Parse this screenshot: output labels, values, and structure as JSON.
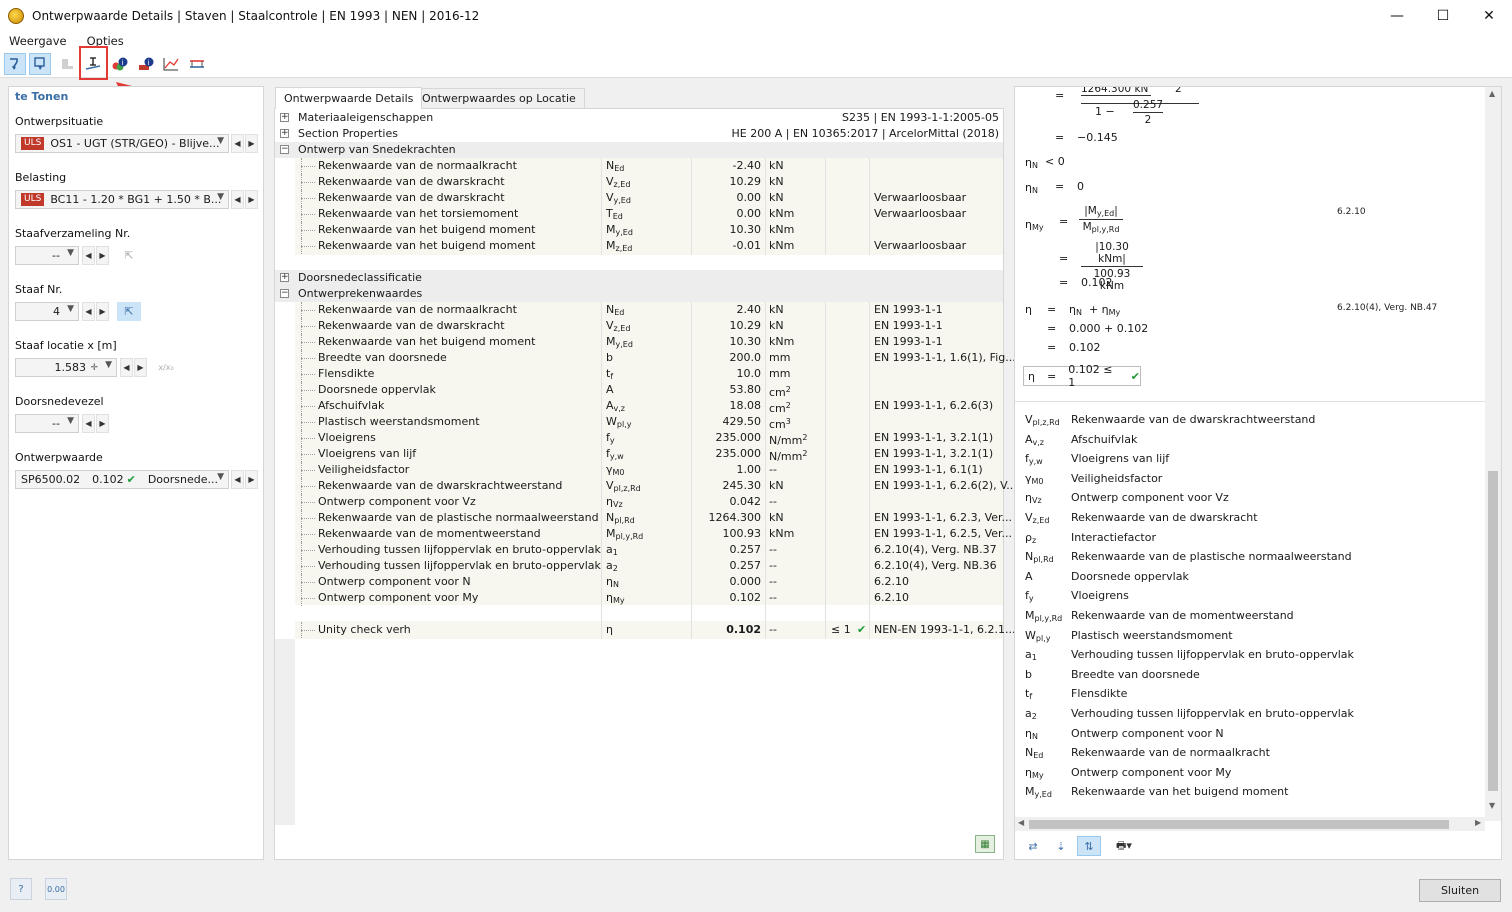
{
  "window": {
    "title": "Ontwerpwaarde Details | Staven | Staalcontrole | EN 1993 | NEN | 2016-12",
    "minimize": "—",
    "maximize": "☐",
    "close": "✕"
  },
  "menu": [
    "Weergave",
    "Opties"
  ],
  "left": {
    "header": "te Tonen",
    "design_situation": {
      "label": "Ontwerpsituatie",
      "badge": "ULS",
      "value": "OS1 - UGT (STR/GEO) - Blijve..."
    },
    "load": {
      "label": "Belasting",
      "badge": "ULS",
      "value": "BC11 - 1.20 * BG1 + 1.50 * B..."
    },
    "member_set": {
      "label": "Staafverzameling Nr.",
      "value": "--"
    },
    "member": {
      "label": "Staaf Nr.",
      "value": "4"
    },
    "location": {
      "label": "Staaf locatie x [m]",
      "value": "1.583",
      "unit_btn": "x/x₀"
    },
    "fiber": {
      "label": "Doorsnedevezel",
      "value": "--"
    },
    "design_value": {
      "label": "Ontwerpwaarde",
      "id": "SP6500.02",
      "ratio": "0.102",
      "type": "Doorsnede..."
    }
  },
  "tabs": [
    "Ontwerpwaarde Details",
    "Ontwerpwaardes op Locatie"
  ],
  "groups": {
    "material": {
      "name": "Materiaaleigenschappen",
      "value": "S235 | EN 1993-1-1:2005-05"
    },
    "section": {
      "name": "Section Properties",
      "value": "HE 200 A | EN 10365:2017 | ArcelorMittal (2018)"
    },
    "forces": {
      "name": "Ontwerp van Snedekrachten"
    },
    "classification": {
      "name": "Doorsnedeclassificatie"
    },
    "design": {
      "name": "Ontwerprekenwaardes"
    }
  },
  "forces_rows": [
    {
      "desc": "Rekenwaarde van de normaalkracht",
      "sym": "N",
      "sub": "Ed",
      "val": "-2.40",
      "unit": "kN",
      "note": ""
    },
    {
      "desc": "Rekenwaarde van de dwarskracht",
      "sym": "V",
      "sub": "z,Ed",
      "val": "10.29",
      "unit": "kN",
      "note": ""
    },
    {
      "desc": "Rekenwaarde van de dwarskracht",
      "sym": "V",
      "sub": "y,Ed",
      "val": "0.00",
      "unit": "kN",
      "note": "Verwaarloosbaar"
    },
    {
      "desc": "Rekenwaarde van het torsiemoment",
      "sym": "T",
      "sub": "Ed",
      "val": "0.00",
      "unit": "kNm",
      "note": "Verwaarloosbaar"
    },
    {
      "desc": "Rekenwaarde van het buigend moment",
      "sym": "M",
      "sub": "y,Ed",
      "val": "10.30",
      "unit": "kNm",
      "note": ""
    },
    {
      "desc": "Rekenwaarde van het buigend moment",
      "sym": "M",
      "sub": "z,Ed",
      "val": "-0.01",
      "unit": "kNm",
      "note": "Verwaarloosbaar"
    }
  ],
  "design_rows": [
    {
      "desc": "Rekenwaarde van de normaalkracht",
      "sym": "N",
      "sub": "Ed",
      "val": "2.40",
      "unit": "kN",
      "note": "EN 1993-1-1"
    },
    {
      "desc": "Rekenwaarde van de dwarskracht",
      "sym": "V",
      "sub": "z,Ed",
      "val": "10.29",
      "unit": "kN",
      "note": "EN 1993-1-1"
    },
    {
      "desc": "Rekenwaarde van het buigend moment",
      "sym": "M",
      "sub": "y,Ed",
      "val": "10.30",
      "unit": "kNm",
      "note": "EN 1993-1-1"
    },
    {
      "desc": "Breedte van doorsnede",
      "sym": "b",
      "sub": "",
      "val": "200.0",
      "unit": "mm",
      "note": "EN 1993-1-1, 1.6(1), Fig..."
    },
    {
      "desc": "Flensdikte",
      "sym": "t",
      "sub": "f",
      "val": "10.0",
      "unit": "mm",
      "note": ""
    },
    {
      "desc": "Doorsnede oppervlak",
      "sym": "A",
      "sub": "",
      "val": "53.80",
      "unit": "cm",
      "usup": "2",
      "note": ""
    },
    {
      "desc": "Afschuifvlak",
      "sym": "A",
      "sub": "v,z",
      "val": "18.08",
      "unit": "cm",
      "usup": "2",
      "note": "EN 1993-1-1, 6.2.6(3)"
    },
    {
      "desc": "Plastisch weerstandsmoment",
      "sym": "W",
      "sub": "pl,y",
      "val": "429.50",
      "unit": "cm",
      "usup": "3",
      "note": ""
    },
    {
      "desc": "Vloeigrens",
      "sym": "f",
      "sub": "y",
      "val": "235.000",
      "unit": "N/mm",
      "usup": "2",
      "note": "EN 1993-1-1, 3.2.1(1)"
    },
    {
      "desc": "Vloeigrens van lijf",
      "sym": "f",
      "sub": "y,w",
      "val": "235.000",
      "unit": "N/mm",
      "usup": "2",
      "note": "EN 1993-1-1, 3.2.1(1)"
    },
    {
      "desc": "Veiligheidsfactor",
      "sym": "γ",
      "sub": "M0",
      "val": "1.00",
      "unit": "--",
      "note": "EN 1993-1-1, 6.1(1)"
    },
    {
      "desc": "Rekenwaarde van de dwarskrachtweerstand",
      "sym": "V",
      "sub": "pl,z,Rd",
      "val": "245.30",
      "unit": "kN",
      "note": "EN 1993-1-1, 6.2.6(2), V..."
    },
    {
      "desc": "Ontwerp component voor Vz",
      "sym": "η",
      "sub": "Vz",
      "val": "0.042",
      "unit": "--",
      "note": ""
    },
    {
      "desc": "Rekenwaarde van de plastische normaalweerstand",
      "sym": "N",
      "sub": "pl,Rd",
      "val": "1264.300",
      "unit": "kN",
      "note": "EN 1993-1-1, 6.2.3, Ver..."
    },
    {
      "desc": "Rekenwaarde van de momentweerstand",
      "sym": "M",
      "sub": "pl,y,Rd",
      "val": "100.93",
      "unit": "kNm",
      "note": "EN 1993-1-1, 6.2.5, Ver..."
    },
    {
      "desc": "Verhouding tussen lijfoppervlak en bruto-oppervlak",
      "sym": "a",
      "sub": "1",
      "val": "0.257",
      "unit": "--",
      "note": "6.2.10(4), Verg. NB.37"
    },
    {
      "desc": "Verhouding tussen lijfoppervlak en bruto-oppervlak",
      "sym": "a",
      "sub": "2",
      "val": "0.257",
      "unit": "--",
      "note": "6.2.10(4), Verg. NB.36"
    },
    {
      "desc": "Ontwerp component voor N",
      "sym": "η",
      "sub": "N",
      "val": "0.000",
      "unit": "--",
      "note": "6.2.10"
    },
    {
      "desc": "Ontwerp component voor My",
      "sym": "η",
      "sub": "My",
      "val": "0.102",
      "unit": "--",
      "note": "6.2.10"
    }
  ],
  "unity": {
    "desc": "Unity check verh",
    "sym": "η",
    "val": "0.102",
    "unit": "--",
    "limit": "≤ 1",
    "check": "✔",
    "note": "NEN-EN 1993-1-1, 6.2.1..."
  },
  "formula": {
    "top_num": "1264.300 kN",
    "top_den2": "2",
    "one_minus": "1 −",
    "f_num": "0.257",
    "f_den": "2",
    "result1": "−0.145",
    "etaN_cond": "< 0",
    "etaN_val": "0",
    "myed_num": "|My,Ed|",
    "mypl_den": "Mpl,y,Rd",
    "num_val": "|10.30 kNm|",
    "den_val": "100.93 kNm",
    "etaMy_result": "0.102",
    "ref1": "6.2.10",
    "eta_sum_terms": "ηN  +  ηMy",
    "eta_sum_vals": "0.000  +  0.102",
    "eta_result": "0.102",
    "ref2": "6.2.10(4), Verg. NB.47",
    "final": "0.102  ≤ 1",
    "eq": "="
  },
  "legend": [
    {
      "sym": "V",
      "sub": "pl,z,Rd",
      "desc": "Rekenwaarde van de dwarskrachtweerstand"
    },
    {
      "sym": "A",
      "sub": "v,z",
      "desc": "Afschuifvlak"
    },
    {
      "sym": "f",
      "sub": "y,w",
      "desc": "Vloeigrens van lijf"
    },
    {
      "sym": "γ",
      "sub": "M0",
      "desc": "Veiligheidsfactor"
    },
    {
      "sym": "η",
      "sub": "Vz",
      "desc": "Ontwerp component voor Vz"
    },
    {
      "sym": "V",
      "sub": "z,Ed",
      "desc": "Rekenwaarde van de dwarskracht"
    },
    {
      "sym": "ρ",
      "sub": "z",
      "desc": "Interactiefactor"
    },
    {
      "sym": "N",
      "sub": "pl,Rd",
      "desc": "Rekenwaarde van de plastische normaalweerstand"
    },
    {
      "sym": "A",
      "sub": "",
      "desc": "Doorsnede oppervlak"
    },
    {
      "sym": "f",
      "sub": "y",
      "desc": "Vloeigrens"
    },
    {
      "sym": "M",
      "sub": "pl,y,Rd",
      "desc": "Rekenwaarde van de momentweerstand"
    },
    {
      "sym": "W",
      "sub": "pl,y",
      "desc": "Plastisch weerstandsmoment"
    },
    {
      "sym": "a",
      "sub": "1",
      "desc": "Verhouding tussen lijfoppervlak en bruto-oppervlak"
    },
    {
      "sym": "b",
      "sub": "",
      "desc": "Breedte van doorsnede"
    },
    {
      "sym": "t",
      "sub": "f",
      "desc": "Flensdikte"
    },
    {
      "sym": "a",
      "sub": "2",
      "desc": "Verhouding tussen lijfoppervlak en bruto-oppervlak"
    },
    {
      "sym": "η",
      "sub": "N",
      "desc": "Ontwerp component voor N"
    },
    {
      "sym": "N",
      "sub": "Ed",
      "desc": "Rekenwaarde van de normaalkracht"
    },
    {
      "sym": "η",
      "sub": "My",
      "desc": "Ontwerp component voor My"
    },
    {
      "sym": "M",
      "sub": "y,Ed",
      "desc": "Rekenwaarde van het buigend moment"
    }
  ],
  "close_button": "Sluiten",
  "status_value": "0.00",
  "colors": {
    "accent": "#3a6ea5",
    "uls": "#c0392b",
    "check": "#1e9a3a",
    "highlight": "#e53935"
  }
}
